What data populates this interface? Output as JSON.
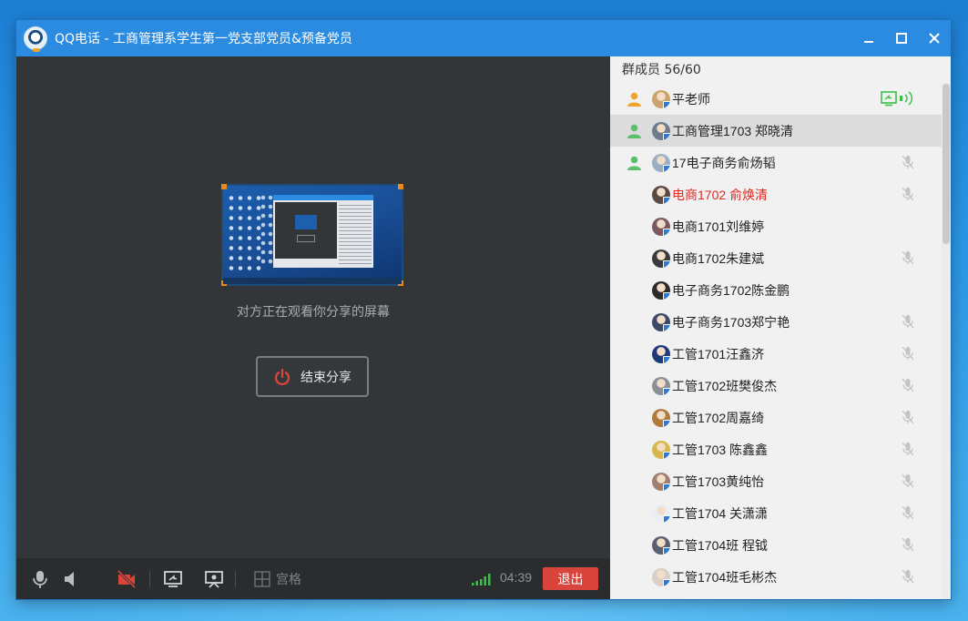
{
  "window": {
    "title": "QQ电话 - 工商管理系学生第一党支部党员&预备党员"
  },
  "main": {
    "share_note": "对方正在观看你分享的屏幕",
    "end_share_label": "结束分享"
  },
  "toolbar": {
    "grid_label": "宫格",
    "timer": "04:39",
    "exit_label": "退出"
  },
  "sidebar": {
    "count_label": "群成员 56/60",
    "members": [
      {
        "name": "平老师",
        "role": "host",
        "avatar_color": "#caa46a",
        "status": "sharing"
      },
      {
        "name": "工商管理1703 郑晓清",
        "role": "member",
        "avatar_color": "#6e7c8c",
        "status": "none",
        "selected": true
      },
      {
        "name": "17电子商务俞炀韬",
        "role": "member",
        "avatar_color": "#9bb0c4",
        "status": "muted"
      },
      {
        "name": "电商1702 俞焕清",
        "role": "none",
        "avatar_color": "#5a4a42",
        "status": "muted",
        "highlight": "red"
      },
      {
        "name": "电商1701刘维婷",
        "role": "none",
        "avatar_color": "#7a5a60",
        "status": "none"
      },
      {
        "name": "电商1702朱建斌",
        "role": "none",
        "avatar_color": "#3a3a3a",
        "status": "muted"
      },
      {
        "name": "电子商务1702陈金鹏",
        "role": "none",
        "avatar_color": "#2e2a28",
        "status": "none"
      },
      {
        "name": "电子商务1703郑宁艳",
        "role": "none",
        "avatar_color": "#3b4a66",
        "status": "muted"
      },
      {
        "name": "工管1701汪鑫济",
        "role": "none",
        "avatar_color": "#1e3a7a",
        "status": "muted"
      },
      {
        "name": "工管1702班樊俊杰",
        "role": "none",
        "avatar_color": "#8a9098",
        "status": "muted"
      },
      {
        "name": "工管1702周嘉绮",
        "role": "none",
        "avatar_color": "#b07a3c",
        "status": "muted"
      },
      {
        "name": "工管1703 陈鑫鑫",
        "role": "none",
        "avatar_color": "#d8b84a",
        "status": "muted"
      },
      {
        "name": "工管1703黄纯怡",
        "role": "none",
        "avatar_color": "#a08070",
        "status": "muted"
      },
      {
        "name": "工管1704 关潇潇",
        "role": "none",
        "avatar_color": "#e8eef4",
        "status": "muted"
      },
      {
        "name": "工管1704班 程钺",
        "role": "none",
        "avatar_color": "#5a6070",
        "status": "muted"
      },
      {
        "name": "工管1704班毛彬杰",
        "role": "none",
        "avatar_color": "#d8d0c8",
        "status": "muted"
      }
    ]
  },
  "colors": {
    "titlebar": "#2b8be0",
    "main_bg": "#333639",
    "toolbar_bg": "#2a2c2e",
    "exit_button": "#d9453d",
    "host_role": "#f0a42a",
    "member_role": "#5cc06a",
    "highlight_name": "#e0281f",
    "share_status": "#3cbf4a"
  },
  "icons": {
    "app": "qq-phone-logo-icon",
    "minimize": "minimize-icon",
    "maximize": "maximize-icon",
    "close": "close-icon",
    "microphone": "microphone-icon",
    "speaker": "speaker-icon",
    "camera_off": "camera-off-icon",
    "screen_share": "screen-share-icon",
    "projector": "projector-icon",
    "grid": "grid-icon",
    "signal": "signal-strength-icon",
    "power": "power-icon",
    "mute": "mic-muted-icon"
  }
}
